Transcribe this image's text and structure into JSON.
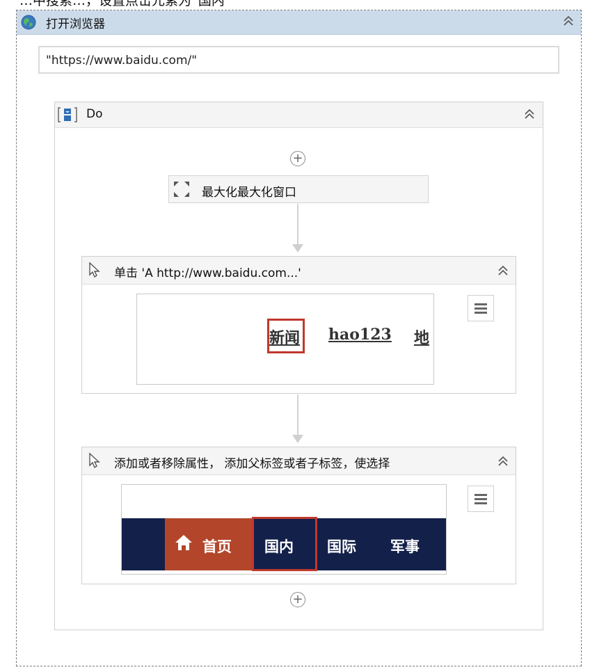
{
  "top_cut_text": "…中搜索…，设置点击元素为“国内”",
  "outer": {
    "title": "打开浏览器",
    "globe_icon": "globe-icon",
    "collapse_icon": "chevron-double-up-icon",
    "url": "\"https://www.baidu.com/\""
  },
  "do_scope": {
    "title": "Do",
    "icon": "do-sequence-icon",
    "collapse_icon": "chevron-double-up-icon"
  },
  "maximize": {
    "title": "最大化最大化窗口",
    "icon": "maximize-arrows-icon"
  },
  "click_activity": {
    "title": "单击 'A  http://www.baidu.com...'",
    "icon": "cursor-icon",
    "collapse_icon": "chevron-double-up-icon",
    "menu_icon": "hamburger-menu-icon",
    "screenshot_links": [
      "新闻",
      "hao123",
      "地"
    ]
  },
  "attr_activity": {
    "title": "添加或者移除属性， 添加父标签或者子标签，使选择",
    "icon": "cursor-icon",
    "collapse_icon": "chevron-double-up-icon",
    "menu_icon": "hamburger-menu-icon",
    "screenshot_nav": {
      "home_icon": "home-icon",
      "home_label": "首页",
      "items": [
        "国内",
        "国际",
        "军事"
      ]
    }
  },
  "colors": {
    "header_blue": "#ccdbea",
    "highlight_red": "#c0392b",
    "nav_dark": "#13204a",
    "nav_home": "#b3462a"
  }
}
